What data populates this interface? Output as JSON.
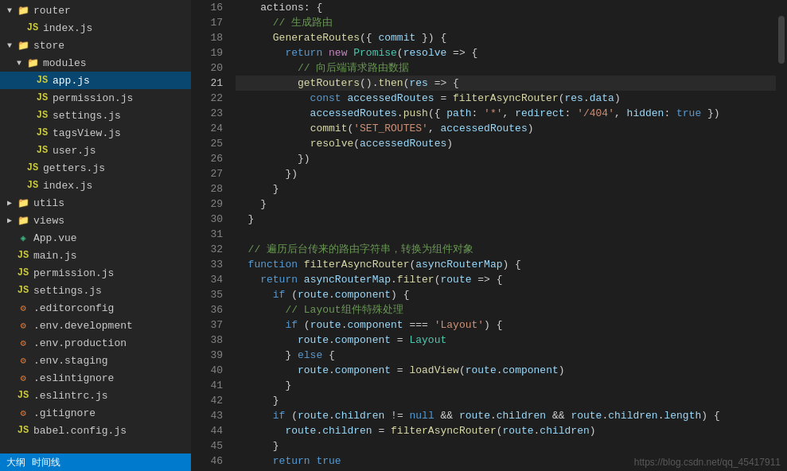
{
  "sidebar": {
    "items": [
      {
        "id": "router",
        "label": "router",
        "type": "folder",
        "indent": 0,
        "open": true,
        "arrow": "▼"
      },
      {
        "id": "index-js-router",
        "label": "index.js",
        "type": "js",
        "indent": 1,
        "arrow": ""
      },
      {
        "id": "store",
        "label": "store",
        "type": "folder",
        "indent": 0,
        "open": true,
        "arrow": "▼"
      },
      {
        "id": "modules",
        "label": "modules",
        "type": "folder",
        "indent": 1,
        "open": true,
        "arrow": "▼"
      },
      {
        "id": "app-js",
        "label": "app.js",
        "type": "js",
        "indent": 2,
        "arrow": "",
        "active": true
      },
      {
        "id": "permission-js",
        "label": "permission.js",
        "type": "js",
        "indent": 2,
        "arrow": ""
      },
      {
        "id": "settings-js",
        "label": "settings.js",
        "type": "js",
        "indent": 2,
        "arrow": ""
      },
      {
        "id": "tagsView-js",
        "label": "tagsView.js",
        "type": "js",
        "indent": 2,
        "arrow": ""
      },
      {
        "id": "user-js",
        "label": "user.js",
        "type": "js",
        "indent": 2,
        "arrow": ""
      },
      {
        "id": "getters-js",
        "label": "getters.js",
        "type": "js",
        "indent": 1,
        "arrow": ""
      },
      {
        "id": "index-js-store",
        "label": "index.js",
        "type": "js",
        "indent": 1,
        "arrow": ""
      },
      {
        "id": "utils",
        "label": "utils",
        "type": "folder",
        "indent": 0,
        "open": false,
        "arrow": "▶"
      },
      {
        "id": "views",
        "label": "views",
        "type": "folder",
        "indent": 0,
        "open": false,
        "arrow": "▶"
      },
      {
        "id": "app-vue",
        "label": "App.vue",
        "type": "vue",
        "indent": 0,
        "arrow": ""
      },
      {
        "id": "main-js",
        "label": "main.js",
        "type": "js",
        "indent": 0,
        "arrow": ""
      },
      {
        "id": "permission-js-root",
        "label": "permission.js",
        "type": "js",
        "indent": 0,
        "arrow": ""
      },
      {
        "id": "settings-js-root",
        "label": "settings.js",
        "type": "js",
        "indent": 0,
        "arrow": ""
      },
      {
        "id": "editorconfig",
        "label": ".editorconfig",
        "type": "config",
        "indent": 0,
        "arrow": ""
      },
      {
        "id": "env-development",
        "label": ".env.development",
        "type": "config",
        "indent": 0,
        "arrow": ""
      },
      {
        "id": "env-production",
        "label": ".env.production",
        "type": "config",
        "indent": 0,
        "arrow": ""
      },
      {
        "id": "env-staging",
        "label": ".env.staging",
        "type": "config",
        "indent": 0,
        "arrow": ""
      },
      {
        "id": "eslintignore",
        "label": ".eslintignore",
        "type": "config",
        "indent": 0,
        "arrow": ""
      },
      {
        "id": "eslintrc-js",
        "label": ".eslintrc.js",
        "type": "js",
        "indent": 0,
        "arrow": ""
      },
      {
        "id": "gitignore",
        "label": ".gitignore",
        "type": "config",
        "indent": 0,
        "arrow": ""
      },
      {
        "id": "babel-config-js",
        "label": "babel.config.js",
        "type": "js",
        "indent": 0,
        "arrow": ""
      }
    ],
    "status": {
      "label1": "大纲",
      "label2": "时间线"
    }
  },
  "editor": {
    "lines": [
      {
        "num": 16,
        "tokens": [
          {
            "t": "plain",
            "v": "    actions: {"
          }
        ]
      },
      {
        "num": 17,
        "tokens": [
          {
            "t": "cmt",
            "v": "      // 生成路由"
          }
        ]
      },
      {
        "num": 18,
        "tokens": [
          {
            "t": "plain",
            "v": "      "
          },
          {
            "t": "fn",
            "v": "GenerateRoutes"
          },
          {
            "t": "plain",
            "v": "({ "
          },
          {
            "t": "prop",
            "v": "commit"
          },
          {
            "t": "plain",
            "v": " }) {"
          }
        ]
      },
      {
        "num": 19,
        "tokens": [
          {
            "t": "kw",
            "v": "        return"
          },
          {
            "t": "plain",
            "v": " "
          },
          {
            "t": "kw2",
            "v": "new"
          },
          {
            "t": "plain",
            "v": " "
          },
          {
            "t": "type",
            "v": "Promise"
          },
          {
            "t": "plain",
            "v": "("
          },
          {
            "t": "prop",
            "v": "resolve"
          },
          {
            "t": "plain",
            "v": " => {"
          }
        ]
      },
      {
        "num": 20,
        "tokens": [
          {
            "t": "cmt",
            "v": "          // 向后端请求路由数据"
          }
        ]
      },
      {
        "num": 21,
        "tokens": [
          {
            "t": "plain",
            "v": "          "
          },
          {
            "t": "fn",
            "v": "getRouters"
          },
          {
            "t": "plain",
            "v": "()."
          },
          {
            "t": "fn",
            "v": "then"
          },
          {
            "t": "plain",
            "v": "("
          },
          {
            "t": "prop",
            "v": "res"
          },
          {
            "t": "plain",
            "v": " => {"
          }
        ],
        "active": true
      },
      {
        "num": 22,
        "tokens": [
          {
            "t": "kw",
            "v": "            const"
          },
          {
            "t": "plain",
            "v": " "
          },
          {
            "t": "var",
            "v": "accessedRoutes"
          },
          {
            "t": "plain",
            "v": " = "
          },
          {
            "t": "fn",
            "v": "filterAsyncRouter"
          },
          {
            "t": "plain",
            "v": "("
          },
          {
            "t": "prop",
            "v": "res"
          },
          {
            "t": "plain",
            "v": "."
          },
          {
            "t": "prop",
            "v": "data"
          },
          {
            "t": "plain",
            "v": ")"
          }
        ]
      },
      {
        "num": 23,
        "tokens": [
          {
            "t": "var",
            "v": "            accessedRoutes"
          },
          {
            "t": "plain",
            "v": "."
          },
          {
            "t": "fn",
            "v": "push"
          },
          {
            "t": "plain",
            "v": "({ "
          },
          {
            "t": "prop",
            "v": "path"
          },
          {
            "t": "plain",
            "v": ": "
          },
          {
            "t": "str",
            "v": "'*'"
          },
          {
            "t": "plain",
            "v": ", "
          },
          {
            "t": "prop",
            "v": "redirect"
          },
          {
            "t": "plain",
            "v": ": "
          },
          {
            "t": "str",
            "v": "'/404'"
          },
          {
            "t": "plain",
            "v": ", "
          },
          {
            "t": "prop",
            "v": "hidden"
          },
          {
            "t": "plain",
            "v": ": "
          },
          {
            "t": "kw",
            "v": "true"
          },
          {
            "t": "plain",
            "v": " })"
          }
        ]
      },
      {
        "num": 24,
        "tokens": [
          {
            "t": "plain",
            "v": "            "
          },
          {
            "t": "fn",
            "v": "commit"
          },
          {
            "t": "plain",
            "v": "("
          },
          {
            "t": "str",
            "v": "'SET_ROUTES'"
          },
          {
            "t": "plain",
            "v": ", "
          },
          {
            "t": "var",
            "v": "accessedRoutes"
          },
          {
            "t": "plain",
            "v": ")"
          }
        ]
      },
      {
        "num": 25,
        "tokens": [
          {
            "t": "plain",
            "v": "            "
          },
          {
            "t": "fn",
            "v": "resolve"
          },
          {
            "t": "plain",
            "v": "("
          },
          {
            "t": "var",
            "v": "accessedRoutes"
          },
          {
            "t": "plain",
            "v": ")"
          }
        ]
      },
      {
        "num": 26,
        "tokens": [
          {
            "t": "plain",
            "v": "          })"
          }
        ]
      },
      {
        "num": 27,
        "tokens": [
          {
            "t": "plain",
            "v": "        })"
          }
        ]
      },
      {
        "num": 28,
        "tokens": [
          {
            "t": "plain",
            "v": "      }"
          }
        ]
      },
      {
        "num": 29,
        "tokens": [
          {
            "t": "plain",
            "v": "    }"
          }
        ]
      },
      {
        "num": 30,
        "tokens": [
          {
            "t": "plain",
            "v": "  }"
          }
        ]
      },
      {
        "num": 31,
        "tokens": [
          {
            "t": "plain",
            "v": ""
          }
        ]
      },
      {
        "num": 32,
        "tokens": [
          {
            "t": "cmt",
            "v": "  // 遍历后台传来的路由字符串，转换为组件对象"
          }
        ]
      },
      {
        "num": 33,
        "tokens": [
          {
            "t": "kw",
            "v": "  function"
          },
          {
            "t": "plain",
            "v": " "
          },
          {
            "t": "fn",
            "v": "filterAsyncRouter"
          },
          {
            "t": "plain",
            "v": "("
          },
          {
            "t": "var",
            "v": "asyncRouterMap"
          },
          {
            "t": "plain",
            "v": ") {"
          }
        ]
      },
      {
        "num": 34,
        "tokens": [
          {
            "t": "kw",
            "v": "    return"
          },
          {
            "t": "plain",
            "v": " "
          },
          {
            "t": "var",
            "v": "asyncRouterMap"
          },
          {
            "t": "plain",
            "v": "."
          },
          {
            "t": "fn",
            "v": "filter"
          },
          {
            "t": "plain",
            "v": "("
          },
          {
            "t": "prop",
            "v": "route"
          },
          {
            "t": "plain",
            "v": " => {"
          }
        ]
      },
      {
        "num": 35,
        "tokens": [
          {
            "t": "kw",
            "v": "      if"
          },
          {
            "t": "plain",
            "v": " ("
          },
          {
            "t": "prop",
            "v": "route"
          },
          {
            "t": "plain",
            "v": "."
          },
          {
            "t": "prop",
            "v": "component"
          },
          {
            "t": "plain",
            "v": ") {"
          }
        ]
      },
      {
        "num": 36,
        "tokens": [
          {
            "t": "cmt",
            "v": "        // Layout组件特殊处理"
          }
        ]
      },
      {
        "num": 37,
        "tokens": [
          {
            "t": "kw",
            "v": "        if"
          },
          {
            "t": "plain",
            "v": " ("
          },
          {
            "t": "prop",
            "v": "route"
          },
          {
            "t": "plain",
            "v": "."
          },
          {
            "t": "prop",
            "v": "component"
          },
          {
            "t": "plain",
            "v": " === "
          },
          {
            "t": "str",
            "v": "'Layout'"
          },
          {
            "t": "plain",
            "v": ") {"
          }
        ]
      },
      {
        "num": 38,
        "tokens": [
          {
            "t": "prop",
            "v": "          route"
          },
          {
            "t": "plain",
            "v": "."
          },
          {
            "t": "prop",
            "v": "component"
          },
          {
            "t": "plain",
            "v": " = "
          },
          {
            "t": "type",
            "v": "Layout"
          }
        ]
      },
      {
        "num": 39,
        "tokens": [
          {
            "t": "plain",
            "v": "        } "
          },
          {
            "t": "kw",
            "v": "else"
          },
          {
            "t": "plain",
            "v": " {"
          }
        ]
      },
      {
        "num": 40,
        "tokens": [
          {
            "t": "prop",
            "v": "          route"
          },
          {
            "t": "plain",
            "v": "."
          },
          {
            "t": "prop",
            "v": "component"
          },
          {
            "t": "plain",
            "v": " = "
          },
          {
            "t": "fn",
            "v": "loadView"
          },
          {
            "t": "plain",
            "v": "("
          },
          {
            "t": "prop",
            "v": "route"
          },
          {
            "t": "plain",
            "v": "."
          },
          {
            "t": "prop",
            "v": "component"
          },
          {
            "t": "plain",
            "v": ")"
          }
        ]
      },
      {
        "num": 41,
        "tokens": [
          {
            "t": "plain",
            "v": "        }"
          }
        ]
      },
      {
        "num": 42,
        "tokens": [
          {
            "t": "plain",
            "v": "      }"
          }
        ]
      },
      {
        "num": 43,
        "tokens": [
          {
            "t": "kw",
            "v": "      if"
          },
          {
            "t": "plain",
            "v": " ("
          },
          {
            "t": "prop",
            "v": "route"
          },
          {
            "t": "plain",
            "v": "."
          },
          {
            "t": "prop",
            "v": "children"
          },
          {
            "t": "plain",
            "v": " != "
          },
          {
            "t": "kw",
            "v": "null"
          },
          {
            "t": "plain",
            "v": " && "
          },
          {
            "t": "prop",
            "v": "route"
          },
          {
            "t": "plain",
            "v": "."
          },
          {
            "t": "prop",
            "v": "children"
          },
          {
            "t": "plain",
            "v": " && "
          },
          {
            "t": "prop",
            "v": "route"
          },
          {
            "t": "plain",
            "v": "."
          },
          {
            "t": "prop",
            "v": "children"
          },
          {
            "t": "plain",
            "v": "."
          },
          {
            "t": "prop",
            "v": "length"
          },
          {
            "t": "plain",
            "v": ") {"
          }
        ]
      },
      {
        "num": 44,
        "tokens": [
          {
            "t": "prop",
            "v": "        route"
          },
          {
            "t": "plain",
            "v": "."
          },
          {
            "t": "prop",
            "v": "children"
          },
          {
            "t": "plain",
            "v": " = "
          },
          {
            "t": "fn",
            "v": "filterAsyncRouter"
          },
          {
            "t": "plain",
            "v": "("
          },
          {
            "t": "prop",
            "v": "route"
          },
          {
            "t": "plain",
            "v": "."
          },
          {
            "t": "prop",
            "v": "children"
          },
          {
            "t": "plain",
            "v": ")"
          }
        ]
      },
      {
        "num": 45,
        "tokens": [
          {
            "t": "plain",
            "v": "      }"
          }
        ]
      },
      {
        "num": 46,
        "tokens": [
          {
            "t": "kw",
            "v": "      return"
          },
          {
            "t": "plain",
            "v": " "
          },
          {
            "t": "kw",
            "v": "true"
          }
        ]
      }
    ],
    "watermark": "https://blog.csdn.net/qq_45417911"
  }
}
